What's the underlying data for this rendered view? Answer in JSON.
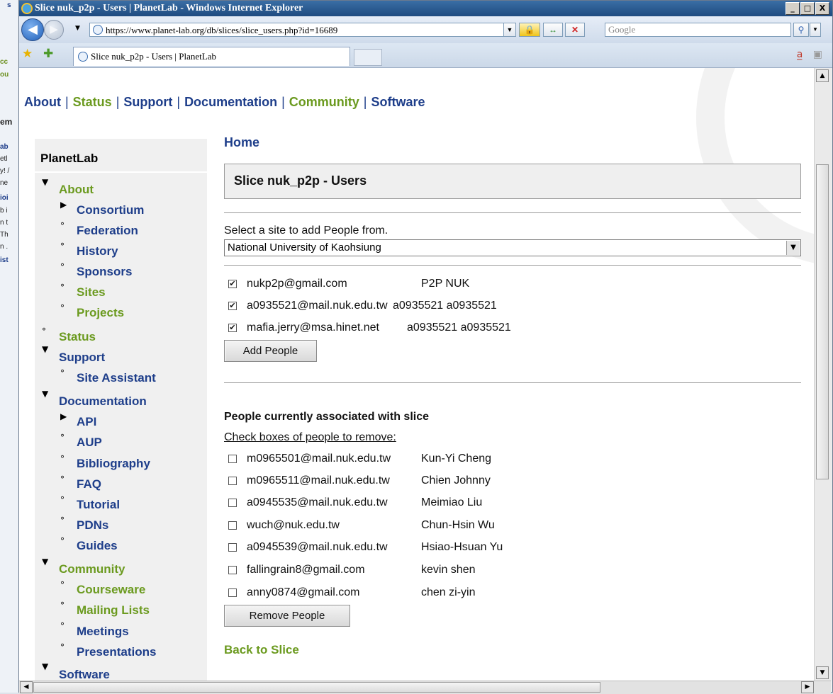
{
  "background_window": {
    "fragments": [
      "s",
      "cc",
      "ou",
      "em",
      "ab",
      "etl",
      "y! /",
      "ne",
      "ioi",
      "b i",
      "n t",
      "Th",
      "n .",
      "ist"
    ]
  },
  "window": {
    "title": "Slice nuk_p2p - Users | PlanetLab - Windows Internet Explorer",
    "controls": {
      "minimize": "_",
      "maximize": "□",
      "close": "X"
    }
  },
  "address_bar": {
    "url": "https://www.planet-lab.org/db/slices/slice_users.php?id=16689",
    "search_placeholder": "Google"
  },
  "tab": {
    "title": "Slice nuk_p2p - Users | PlanetLab"
  },
  "topnav": {
    "items": [
      "About",
      "Status",
      "Support",
      "Documentation",
      "Community",
      "Software"
    ],
    "separator": "|"
  },
  "sidebar": {
    "title": "PlanetLab",
    "items": [
      {
        "label": "About"
      },
      {
        "label": "Consortium"
      },
      {
        "label": "Federation"
      },
      {
        "label": "History"
      },
      {
        "label": "Sponsors"
      },
      {
        "label": "Sites"
      },
      {
        "label": "Projects"
      },
      {
        "label": "Status"
      },
      {
        "label": "Support"
      },
      {
        "label": "Site Assistant"
      },
      {
        "label": "Documentation"
      },
      {
        "label": "API"
      },
      {
        "label": "AUP"
      },
      {
        "label": "Bibliography"
      },
      {
        "label": "FAQ"
      },
      {
        "label": "Tutorial"
      },
      {
        "label": "PDNs"
      },
      {
        "label": "Guides"
      },
      {
        "label": "Community"
      },
      {
        "label": "Courseware"
      },
      {
        "label": "Mailing Lists"
      },
      {
        "label": "Meetings"
      },
      {
        "label": "Presentations"
      },
      {
        "label": "Software"
      }
    ]
  },
  "main": {
    "home": "Home",
    "page_title": "Slice nuk_p2p - Users",
    "site_label": "Select a site to add People from.",
    "site_selected": "National University of Kaohsiung",
    "add_people": [
      {
        "email": "nukp2p@gmail.com",
        "name": "P2P NUK",
        "checked": true
      },
      {
        "email": "a0935521@mail.nuk.edu.tw",
        "name": "a0935521 a0935521",
        "checked": true
      },
      {
        "email": "mafia.jerry@msa.hinet.net",
        "name": "a0935521 a0935521",
        "checked": true
      }
    ],
    "add_button": "Add People",
    "current_heading": "People currently associated with slice",
    "remove_instructions": "Check boxes of people to remove:",
    "current_people": [
      {
        "email": "m0965501@mail.nuk.edu.tw",
        "name": "Kun-Yi Cheng",
        "checked": false
      },
      {
        "email": "m0965511@mail.nuk.edu.tw",
        "name": "Chien Johnny",
        "checked": false
      },
      {
        "email": "a0945535@mail.nuk.edu.tw",
        "name": "Meimiao Liu",
        "checked": false
      },
      {
        "email": "wuch@nuk.edu.tw",
        "name": "Chun-Hsin Wu",
        "checked": false
      },
      {
        "email": "a0945539@mail.nuk.edu.tw",
        "name": "Hsiao-Hsuan Yu",
        "checked": false
      },
      {
        "email": "fallingrain8@gmail.com",
        "name": "kevin shen",
        "checked": false
      },
      {
        "email": "anny0874@gmail.com",
        "name": "chen zi-yin",
        "checked": false
      }
    ],
    "remove_button": "Remove People",
    "back_link": "Back to Slice"
  }
}
